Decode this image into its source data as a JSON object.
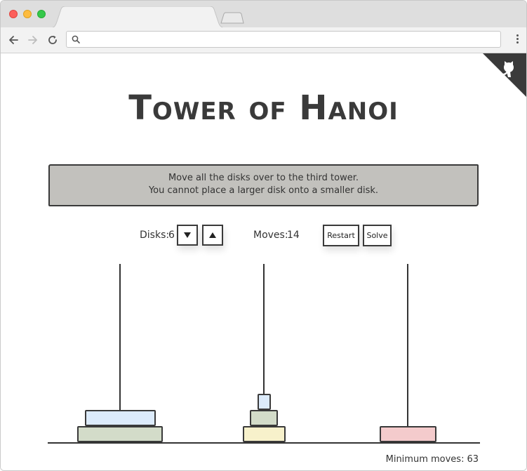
{
  "browser": {
    "address_placeholder": "",
    "colors": {
      "close": "#fc605c",
      "minimize": "#fdbc40",
      "maximize": "#34c84a"
    }
  },
  "page": {
    "title": "Tower of Hanoi",
    "instructions": {
      "line1": "Move all the disks over to the third tower.",
      "line2": "You cannot place a larger disk onto a smaller disk."
    },
    "controls": {
      "disks_label": "Disks:",
      "disks_value": "6",
      "decrease_icon": "triangle-down-icon",
      "increase_icon": "triangle-up-icon",
      "moves_label": "Moves:",
      "moves_value": "14",
      "restart_label": "Restart",
      "solve_label": "Solve"
    },
    "game": {
      "towers": [
        {
          "name": "tower-1",
          "disks": [
            {
              "size": 6,
              "color": "#d3dcc9"
            },
            {
              "size": 5,
              "color": "#dcebfb"
            }
          ]
        },
        {
          "name": "tower-2",
          "disks": [
            {
              "size": 3,
              "color": "#f7f1cb"
            },
            {
              "size": 2,
              "color": "#d3dcc9"
            },
            {
              "size": 1,
              "color": "#dcebfb"
            }
          ]
        },
        {
          "name": "tower-3",
          "disks": [
            {
              "size": 4,
              "color": "#f4cbcc"
            }
          ]
        }
      ]
    },
    "min_moves_label": "Minimum moves:",
    "min_moves_value": "63",
    "github_corner_icon": "octocat-icon"
  }
}
